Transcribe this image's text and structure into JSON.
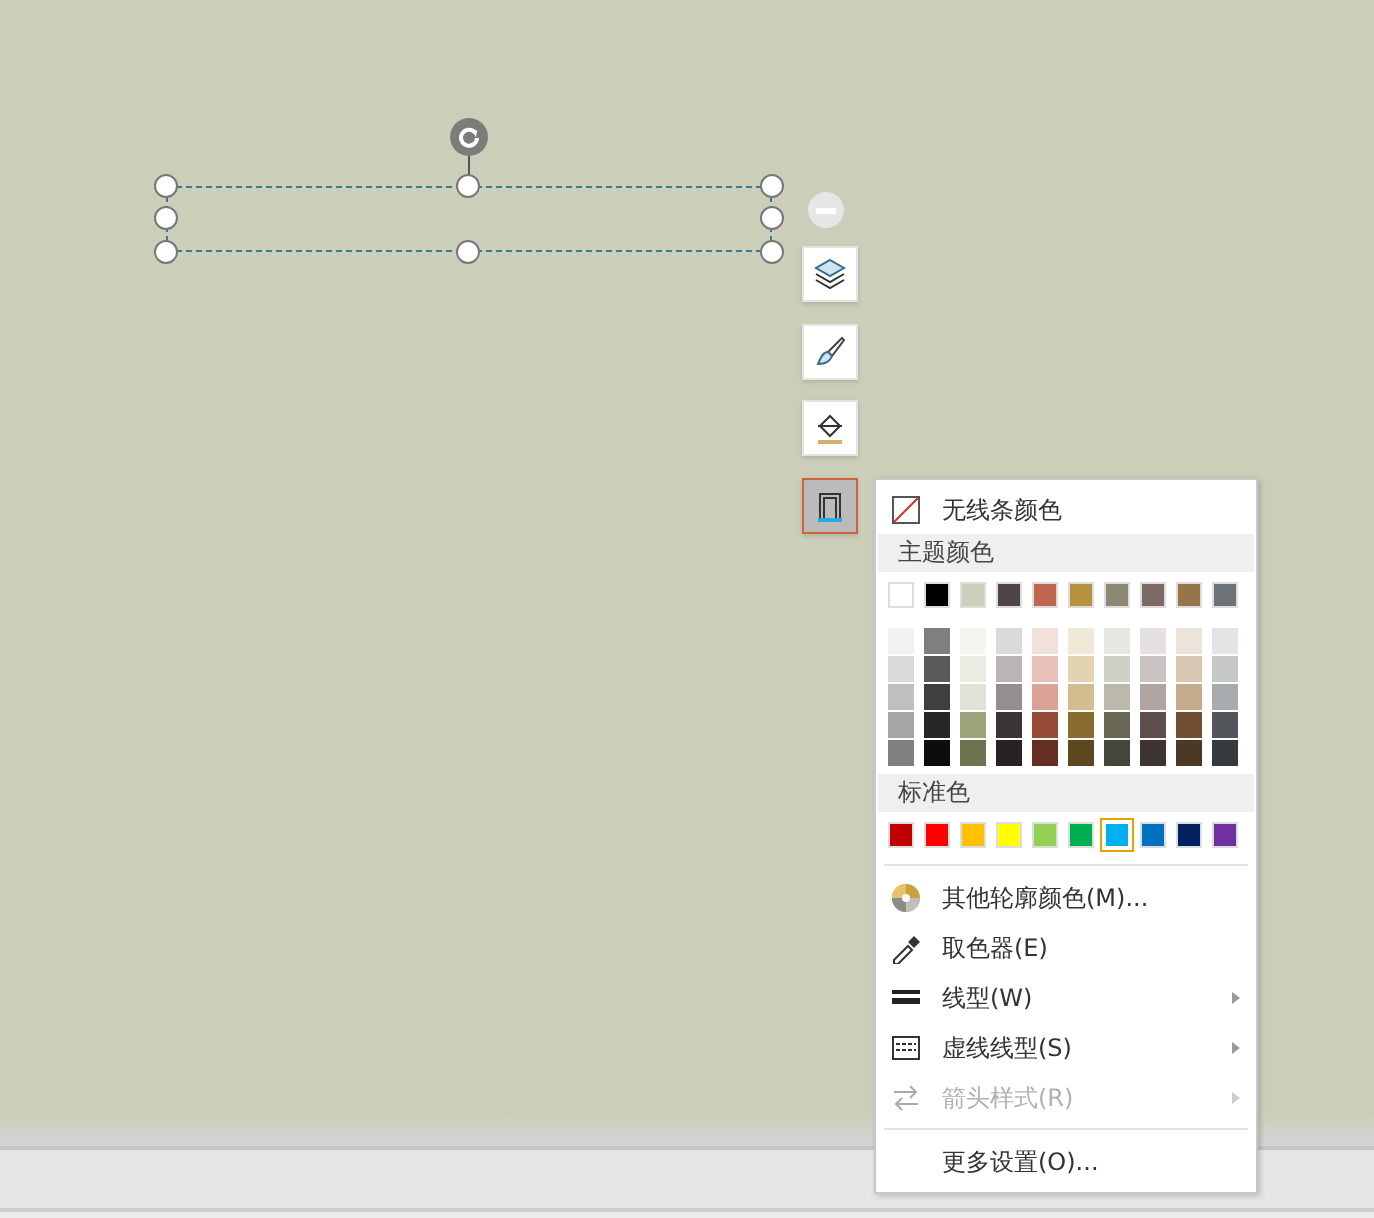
{
  "shape": {
    "selected": true
  },
  "toolbar": [
    {
      "selected": false
    },
    {
      "selected": false
    },
    {
      "selected": false
    },
    {
      "selected": true
    }
  ],
  "menu": {
    "no_line": {
      "label": "无线条颜色"
    },
    "theme_header": "主题颜色",
    "theme_colors": [
      {
        "color": "#ffffff",
        "shades": [
          {
            "color": "#f2f2f2"
          },
          {
            "color": "#d9d9d9"
          },
          {
            "color": "#bfbfbf"
          },
          {
            "color": "#a6a6a6"
          },
          {
            "color": "#808080"
          }
        ]
      },
      {
        "color": "#000000",
        "shades": [
          {
            "color": "#7f7f7f"
          },
          {
            "color": "#595959"
          },
          {
            "color": "#3f3f3f"
          },
          {
            "color": "#262626"
          },
          {
            "color": "#0d0d0d"
          }
        ]
      },
      {
        "color": "#cccfbc",
        "shades": [
          {
            "color": "#f4f5f1"
          },
          {
            "color": "#ebebe4"
          },
          {
            "color": "#e0e2d7"
          },
          {
            "color": "#9ea27a"
          },
          {
            "color": "#6e7450"
          }
        ]
      },
      {
        "color": "#4f4547",
        "shades": [
          {
            "color": "#dcd9d9"
          },
          {
            "color": "#b9b4b5"
          },
          {
            "color": "#958e8f"
          },
          {
            "color": "#3b3435"
          },
          {
            "color": "#282323"
          }
        ]
      },
      {
        "color": "#c0664e",
        "shades": [
          {
            "color": "#f2e0db"
          },
          {
            "color": "#e6c1b8"
          },
          {
            "color": "#d9a295"
          },
          {
            "color": "#974a36"
          },
          {
            "color": "#642f22"
          }
        ]
      },
      {
        "color": "#b8913f",
        "shades": [
          {
            "color": "#f1e9d8"
          },
          {
            "color": "#e3d3b2"
          },
          {
            "color": "#d4bd8c"
          },
          {
            "color": "#8a6c2e"
          },
          {
            "color": "#5c481f"
          }
        ]
      },
      {
        "color": "#8c8a74",
        "shades": [
          {
            "color": "#e8e8e3"
          },
          {
            "color": "#d1d0c7"
          },
          {
            "color": "#bab9ab"
          },
          {
            "color": "#696857"
          },
          {
            "color": "#46453a"
          }
        ]
      },
      {
        "color": "#7d6a66",
        "shades": [
          {
            "color": "#e5e1e0"
          },
          {
            "color": "#cbc3c1"
          },
          {
            "color": "#b1a5a2"
          },
          {
            "color": "#5e4f4c"
          },
          {
            "color": "#3e3533"
          }
        ]
      },
      {
        "color": "#977549",
        "shades": [
          {
            "color": "#ece3d9"
          },
          {
            "color": "#d9c7b3"
          },
          {
            "color": "#c6ab8d"
          },
          {
            "color": "#714f34"
          },
          {
            "color": "#4b3925"
          }
        ]
      },
      {
        "color": "#6d7277",
        "shades": [
          {
            "color": "#e2e3e4"
          },
          {
            "color": "#c5c7c9"
          },
          {
            "color": "#a8abae"
          },
          {
            "color": "#525559"
          },
          {
            "color": "#36393b"
          }
        ]
      }
    ],
    "standard_header": "标准色",
    "standard_colors": [
      {
        "color": "#c00000",
        "selected": false
      },
      {
        "color": "#ff0000",
        "selected": false
      },
      {
        "color": "#ffc000",
        "selected": false
      },
      {
        "color": "#ffff00",
        "selected": false
      },
      {
        "color": "#92d050",
        "selected": false
      },
      {
        "color": "#00b050",
        "selected": false
      },
      {
        "color": "#00b0f0",
        "selected": true
      },
      {
        "color": "#0070c0",
        "selected": false
      },
      {
        "color": "#002060",
        "selected": false
      },
      {
        "color": "#7030a0",
        "selected": false
      }
    ],
    "items": [
      {
        "kind": "colors",
        "label": "其他轮廓颜色(M)...",
        "submenu": false,
        "disabled": false
      },
      {
        "kind": "picker",
        "label": "取色器(E)",
        "submenu": false,
        "disabled": false
      },
      {
        "kind": "weight",
        "label": "线型(W)",
        "submenu": true,
        "disabled": false
      },
      {
        "kind": "dash",
        "label": "虚线线型(S)",
        "submenu": true,
        "disabled": false
      },
      {
        "kind": "arrow",
        "label": "箭头样式(R)",
        "submenu": true,
        "disabled": true
      },
      {
        "kind": "separator"
      },
      {
        "kind": "more",
        "label": "更多设置(O)...",
        "submenu": false,
        "disabled": false
      }
    ]
  }
}
